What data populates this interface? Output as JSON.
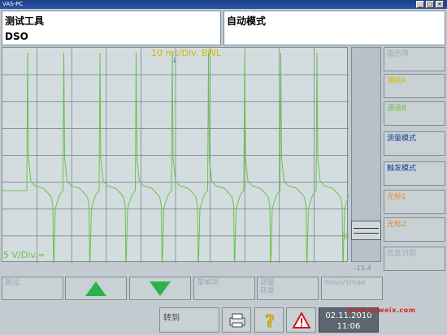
{
  "window": {
    "title": "VAS-PC",
    "controls": [
      "_",
      "□",
      "×"
    ]
  },
  "header": {
    "left_title": "测试工具",
    "left_sub": "DSO",
    "right_title": "自动模式"
  },
  "scope": {
    "timebase": "10 ms/Div. BWL",
    "vscale": "5 V/Div.=",
    "zero_marker": "0",
    "scroll_value": "-15.4",
    "trigger_marker": "↓"
  },
  "side_buttons": [
    {
      "label": "隐示项",
      "color": "#9aa7af"
    },
    {
      "label": "通道A",
      "color": "#d9b600"
    },
    {
      "label": "通道B",
      "color": "#6cc04a"
    },
    {
      "label": "测量模式",
      "color": "#1a3c8c"
    },
    {
      "label": "触发模式",
      "color": "#1a3c8c"
    },
    {
      "label": "光标1",
      "color": "#e08a2a"
    },
    {
      "label": "光标2",
      "color": "#e08a2a"
    },
    {
      "label": "信息识别",
      "color": "#9aa7af"
    }
  ],
  "bottom_buttons": [
    {
      "label": "跳过"
    },
    {
      "label": "up-arrow-icon"
    },
    {
      "label": "down-arrow-icon"
    },
    {
      "label": "菜单项"
    },
    {
      "label": "测量\n转发"
    },
    {
      "label": "Ymin/Ymax"
    }
  ],
  "footer": {
    "goto_label": "转到",
    "date": "02.11.2010",
    "time": "11:06",
    "watermark": "www.gzweix.com",
    "icons": [
      "printer-icon",
      "help-icon",
      "warning-icon"
    ]
  },
  "chart_data": {
    "type": "line",
    "title": "",
    "xlabel": "",
    "ylabel": "",
    "grid": true,
    "series": [
      {
        "values": [
          0,
          0,
          10,
          1.5,
          0.8,
          0.5,
          0.3,
          -0.3,
          -0.5,
          -7,
          -1.2,
          -0.4,
          0,
          0,
          10,
          1.5,
          0.8,
          0.5,
          0.3,
          -0.3,
          -0.5,
          -7,
          -1.2,
          -0.4,
          0
        ],
        "color": "#6cc04a"
      }
    ]
  }
}
